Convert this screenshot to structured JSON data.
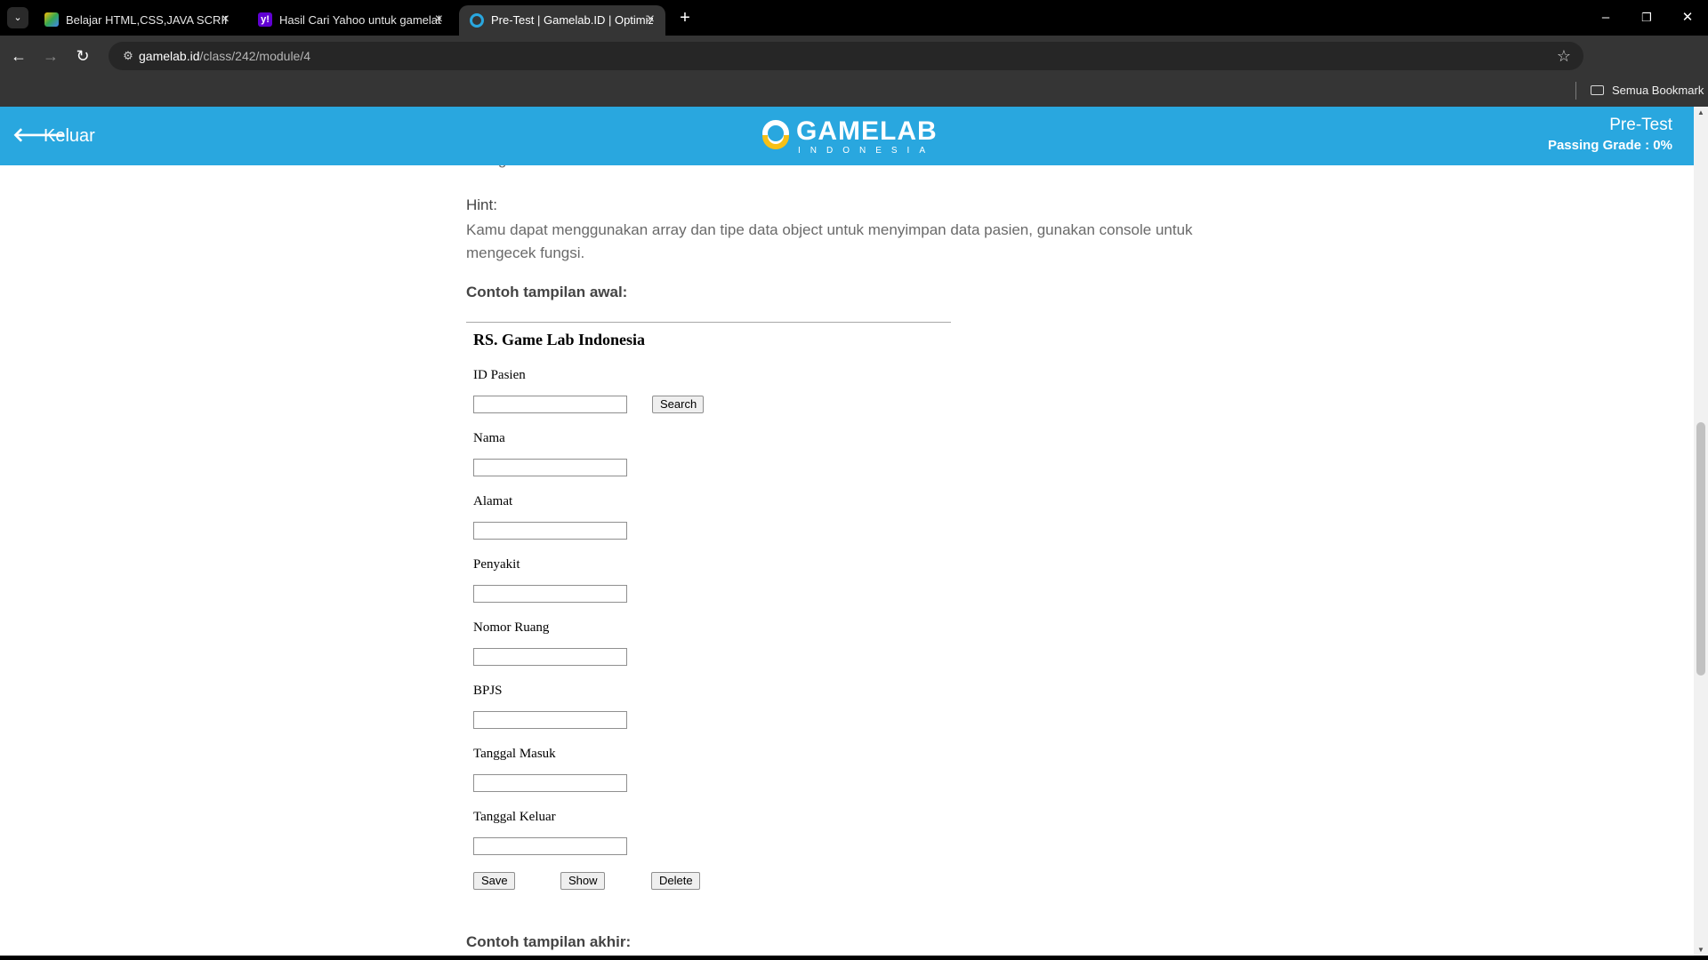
{
  "browser": {
    "tabs": [
      {
        "title": "Belajar HTML,CSS,JAVA SCRIPT",
        "favicon": "google-drive-icon",
        "active": false
      },
      {
        "title": "Hasil Cari Yahoo untuk gamelab",
        "favicon": "yahoo-icon",
        "active": false
      },
      {
        "title": "Pre-Test | Gamelab.ID | Optimize",
        "favicon": "gamelab-icon",
        "active": true
      }
    ],
    "url_host": "gamelab.id",
    "url_path": "/class/242/module/4",
    "bookmarks_label": "Semua Bookmark"
  },
  "header": {
    "back_label": "Keluar",
    "logo_word": "GAMELAB",
    "logo_sub": "INDONESIA",
    "title": "Pre-Test",
    "passing_grade": "Passing Grade : 0%",
    "color": "#29a7df"
  },
  "content": {
    "cut_text": "hilang.",
    "hint_label": "Hint:",
    "hint_text": "Kamu dapat menggunakan array dan tipe data object untuk menyimpan data pasien, gunakan console untuk mengecek fungsi.",
    "contoh_awal": "Contoh tampilan awal:",
    "contoh_akhir": "Contoh tampilan akhir:"
  },
  "demo_form": {
    "title": "RS. Game Lab Indonesia",
    "fields": [
      "ID Pasien",
      "Nama",
      "Alamat",
      "Penyakit",
      "Nomor Ruang",
      "BPJS",
      "Tanggal Masuk",
      "Tanggal Keluar"
    ],
    "search_button": "Search",
    "save_button": "Save",
    "show_button": "Show",
    "delete_button": "Delete"
  }
}
